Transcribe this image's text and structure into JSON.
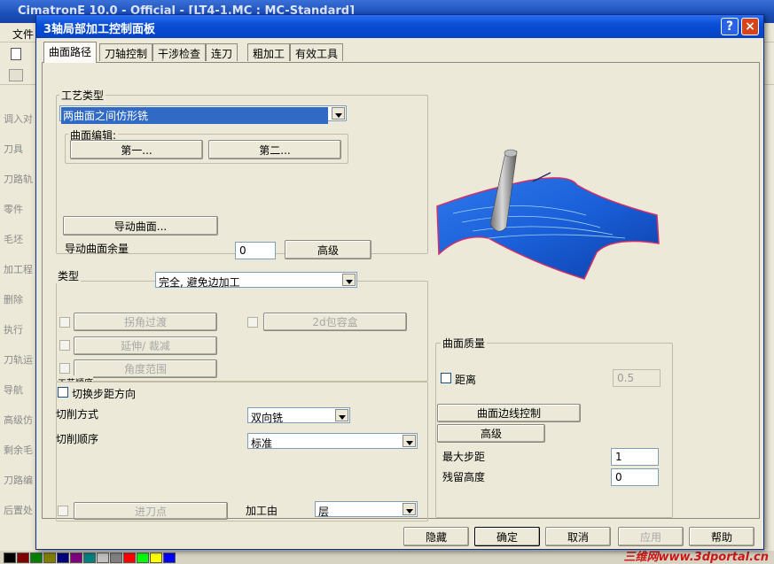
{
  "background_app": {
    "title": "CimatronE 10.0 - Official - [LT4-1.MC : MC-Standard]",
    "menu_file": "文件",
    "sidebar_labels": [
      "调入对",
      "刀具",
      "刀路轨",
      "零件",
      "毛坯",
      "加工程",
      "删除",
      "执行",
      "刀轨运",
      "导航",
      "高级仿",
      "剩余毛",
      "刀路编",
      "后置处"
    ],
    "palette_colors": [
      "#000000",
      "#800000",
      "#008000",
      "#808000",
      "#000080",
      "#800080",
      "#008080",
      "#c0c0c0",
      "#808080",
      "#ff0000",
      "#00ff00",
      "#ffff00",
      "#0000ff"
    ],
    "watermark": "三维网www.3dportal.cn"
  },
  "dialog": {
    "title": "3轴局部加工控制面板",
    "help_glyph": "?",
    "close_glyph": "×",
    "tabs": [
      "曲面路径",
      "刀轴控制",
      "干涉检查",
      "连刀",
      "粗加工",
      "有效工具"
    ],
    "process_group_label": "工艺类型",
    "process_type_value": "两曲面之间仿形铣",
    "surface_edit_label": "曲面编辑:",
    "first_button": "第一...",
    "second_button": "第二...",
    "guide_surface_button": "导动曲面...",
    "guide_allowance_label": "导动曲面余量",
    "guide_allowance_value": "0",
    "advanced_button": "高级",
    "type_label": "类型",
    "type_value": "完全, 避免边加工",
    "corner_transition": "拐角过渡",
    "bbox_2d": "2d包容盒",
    "extend_trim": "延伸/ 裁减",
    "angle_range": "角度范围",
    "process_order_label": "工艺顺序",
    "switch_step_direction": "切换步距方向",
    "cut_method_label": "切削方式",
    "cut_method_value": "双向铣",
    "cut_order_label": "切削顺序",
    "cut_order_value": "标准",
    "entry_point": "进刀点",
    "machine_by_label": "加工由",
    "machine_by_value": "层",
    "surface_quality_label": "曲面质量",
    "distance_label": "距离",
    "distance_value": "0.5",
    "surface_edge_control": "曲面边线控制",
    "advanced_button_2": "高级",
    "max_step_label": "最大步距",
    "max_step_value": "1",
    "scallop_height_label": "残留高度",
    "scallop_height_value": "0",
    "buttons": {
      "hide": "隐藏",
      "ok": "确定",
      "cancel": "取消",
      "apply": "应用",
      "help": "帮助"
    }
  },
  "colors": {
    "surface_blue": "#1a5fd8",
    "surface_edge": "#d0306a",
    "tool_gray": "#8a8a8a",
    "dialog_face": "#ece9d8",
    "title_blue": "#0a4fd8"
  }
}
